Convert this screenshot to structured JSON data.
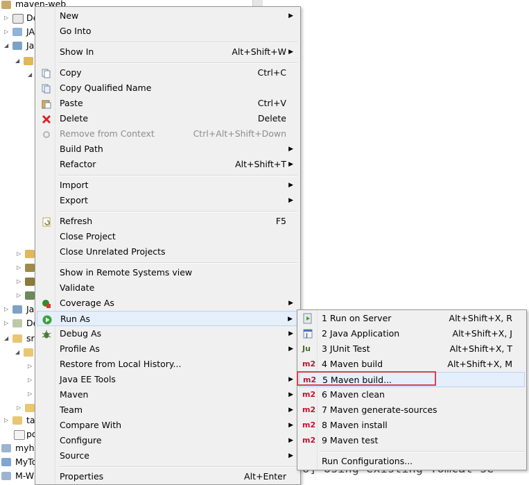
{
  "tree": {
    "rows": [
      {
        "label": "maven-web"
      },
      {
        "label": "De"
      },
      {
        "label": "JA"
      },
      {
        "label": "Ja"
      },
      {
        "label": "Ja"
      },
      {
        "label": "De"
      },
      {
        "label": "sr"
      },
      {
        "label": "ta"
      },
      {
        "label": "po"
      },
      {
        "label": "myhe"
      },
      {
        "label": "MyTo"
      },
      {
        "label": "M-W"
      }
    ]
  },
  "console": {
    "text": "o] Using existing Tomcat se"
  },
  "menu": {
    "items": [
      {
        "label": "New",
        "shortcut": "",
        "submenu": true
      },
      {
        "label": "Go Into",
        "shortcut": "",
        "submenu": false
      },
      {
        "label": "Show In",
        "shortcut": "Alt+Shift+W",
        "submenu": true
      },
      {
        "label": "Copy",
        "shortcut": "Ctrl+C",
        "submenu": false
      },
      {
        "label": "Copy Qualified Name",
        "shortcut": "",
        "submenu": false
      },
      {
        "label": "Paste",
        "shortcut": "Ctrl+V",
        "submenu": false
      },
      {
        "label": "Delete",
        "shortcut": "Delete",
        "submenu": false
      },
      {
        "label": "Remove from Context",
        "shortcut": "Ctrl+Alt+Shift+Down",
        "submenu": false
      },
      {
        "label": "Build Path",
        "shortcut": "",
        "submenu": true
      },
      {
        "label": "Refactor",
        "shortcut": "Alt+Shift+T",
        "submenu": true
      },
      {
        "label": "Import",
        "shortcut": "",
        "submenu": true
      },
      {
        "label": "Export",
        "shortcut": "",
        "submenu": true
      },
      {
        "label": "Refresh",
        "shortcut": "F5",
        "submenu": false
      },
      {
        "label": "Close Project",
        "shortcut": "",
        "submenu": false
      },
      {
        "label": "Close Unrelated Projects",
        "shortcut": "",
        "submenu": false
      },
      {
        "label": "Show in Remote Systems view",
        "shortcut": "",
        "submenu": false
      },
      {
        "label": "Validate",
        "shortcut": "",
        "submenu": false
      },
      {
        "label": "Coverage As",
        "shortcut": "",
        "submenu": true
      },
      {
        "label": "Run As",
        "shortcut": "",
        "submenu": true
      },
      {
        "label": "Debug As",
        "shortcut": "",
        "submenu": true
      },
      {
        "label": "Profile As",
        "shortcut": "",
        "submenu": true
      },
      {
        "label": "Restore from Local History...",
        "shortcut": "",
        "submenu": false
      },
      {
        "label": "Java EE Tools",
        "shortcut": "",
        "submenu": true
      },
      {
        "label": "Maven",
        "shortcut": "",
        "submenu": true
      },
      {
        "label": "Team",
        "shortcut": "",
        "submenu": true
      },
      {
        "label": "Compare With",
        "shortcut": "",
        "submenu": true
      },
      {
        "label": "Configure",
        "shortcut": "",
        "submenu": true
      },
      {
        "label": "Source",
        "shortcut": "",
        "submenu": true
      },
      {
        "label": "Properties",
        "shortcut": "Alt+Enter",
        "submenu": false
      }
    ],
    "submenu_arrow": "▶"
  },
  "run_as": {
    "items": [
      {
        "label": "1 Run on Server",
        "shortcut": "Alt+Shift+X, R",
        "icon": "server-icon"
      },
      {
        "label": "2 Java Application",
        "shortcut": "Alt+Shift+X, J",
        "icon": "java-app-icon"
      },
      {
        "label": "3 JUnit Test",
        "shortcut": "Alt+Shift+X, T",
        "icon": "junit-icon"
      },
      {
        "label": "4 Maven build",
        "shortcut": "Alt+Shift+X, M",
        "icon": "m2-icon"
      },
      {
        "label": "5 Maven build...",
        "shortcut": "",
        "icon": "m2-icon"
      },
      {
        "label": "6 Maven clean",
        "shortcut": "",
        "icon": "m2-icon"
      },
      {
        "label": "7 Maven generate-sources",
        "shortcut": "",
        "icon": "m2-icon"
      },
      {
        "label": "8 Maven install",
        "shortcut": "",
        "icon": "m2-icon"
      },
      {
        "label": "9 Maven test",
        "shortcut": "",
        "icon": "m2-icon"
      },
      {
        "label": "Run Configurations...",
        "shortcut": "",
        "icon": ""
      }
    ],
    "icon_text": {
      "m2": "m2",
      "junit": "Ju"
    }
  },
  "colors": {
    "highlight": "#e5eefb",
    "annotation": "#d9414b",
    "maven_red": "#c8102e"
  }
}
